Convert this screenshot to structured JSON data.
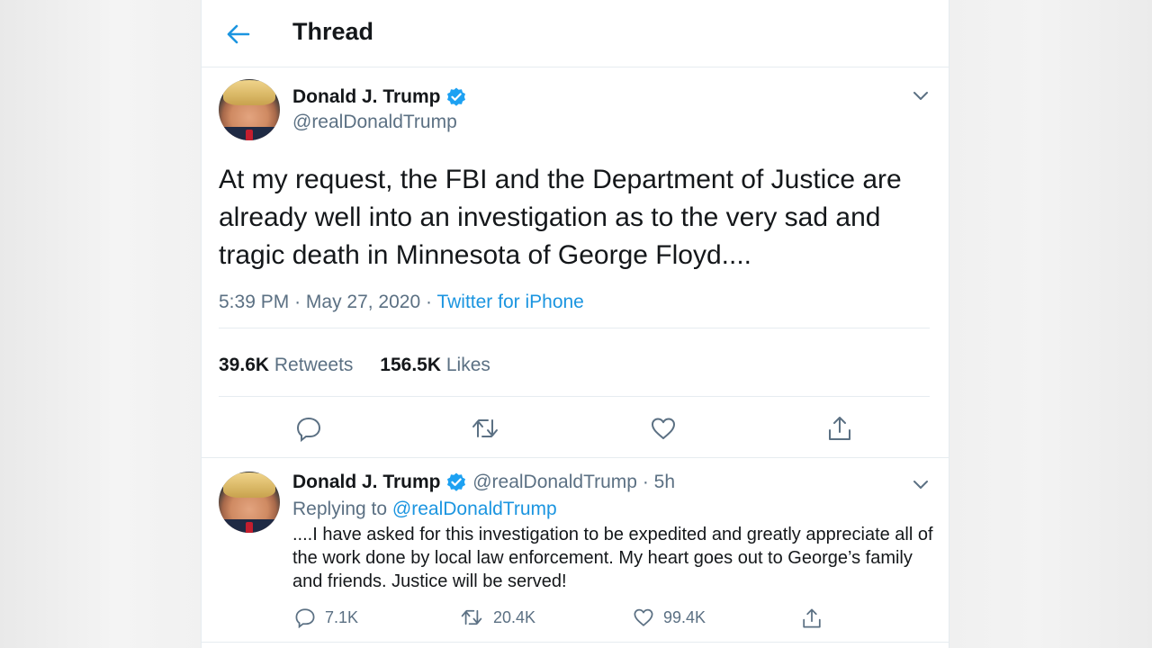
{
  "header": {
    "title": "Thread"
  },
  "main_tweet": {
    "author_name": "Donald J. Trump",
    "author_handle": "@realDonaldTrump",
    "text": "At my request, the FBI and the Department of Justice are already well into an investigation as to the very sad and tragic death in Minnesota of George Floyd....",
    "time": "5:39 PM",
    "date": "May 27, 2020",
    "source": "Twitter for iPhone",
    "retweets_count": "39.6K",
    "retweets_label": "Retweets",
    "likes_count": "156.5K",
    "likes_label": "Likes"
  },
  "reply_tweet": {
    "author_name": "Donald J. Trump",
    "author_handle": "@realDonaldTrump",
    "age": "5h",
    "replying_to_label": "Replying to",
    "replying_to_handle": "@realDonaldTrump",
    "text": "....I have asked for this investigation to be expedited and greatly appreciate all of the work done by local law enforcement. My heart goes out to George’s family and friends. Justice will be served!",
    "reply_count": "7.1K",
    "retweet_count": "20.4K",
    "like_count": "99.4K"
  },
  "colors": {
    "accent": "#1b95e0",
    "secondary_text": "#5b7083",
    "verified": "#1da1f2"
  }
}
